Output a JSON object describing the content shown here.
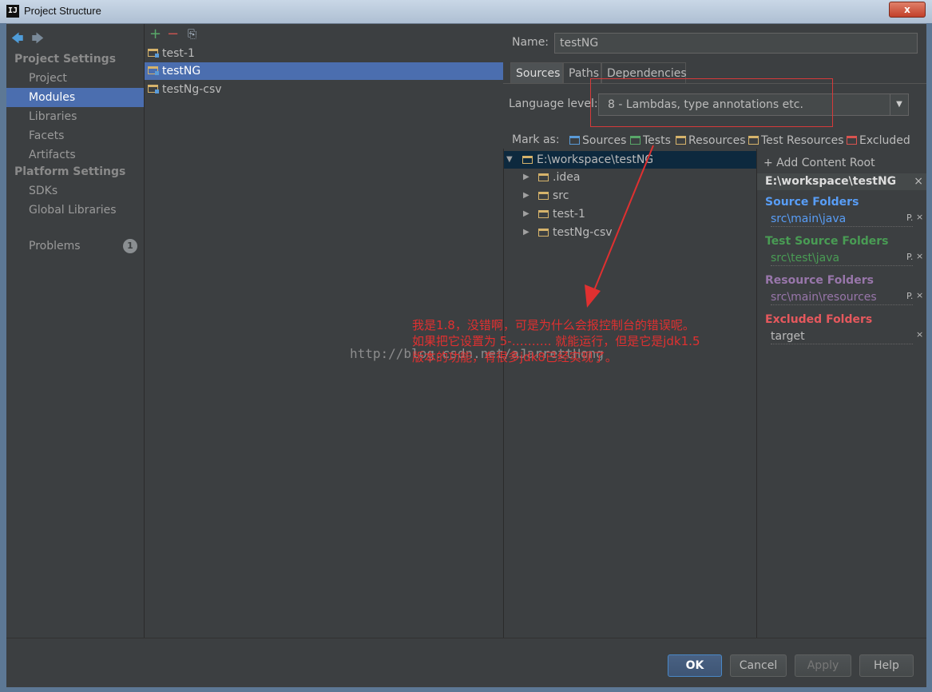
{
  "window": {
    "title": "Project Structure",
    "app_icon": "IJ",
    "close_label": "x"
  },
  "nav": {
    "back_icon": "🡄",
    "forward_icon": "🡆"
  },
  "sidebar": {
    "project_settings_header": "Project Settings",
    "project_items": [
      "Project",
      "Modules",
      "Libraries",
      "Facets",
      "Artifacts"
    ],
    "platform_settings_header": "Platform Settings",
    "platform_items": [
      "SDKs",
      "Global Libraries"
    ],
    "problems_label": "Problems",
    "problems_count": "1",
    "selected": "Modules"
  },
  "modules": {
    "toolbar": {
      "add": "+",
      "remove": "−",
      "copy": "⎘"
    },
    "items": [
      "test-1",
      "testNG",
      "testNg-csv"
    ],
    "selected": "testNG"
  },
  "detail": {
    "name_label": "Name:",
    "name_value": "testNG",
    "tabs": [
      "Sources",
      "Paths",
      "Dependencies"
    ],
    "active_tab": "Sources",
    "language_level_label": "Language level:",
    "language_level_value": "8 - Lambdas, type annotations etc.",
    "mark_as_label": "Mark as:",
    "mark_types": [
      {
        "label": "Sources",
        "color": "#5a9bd8"
      },
      {
        "label": "Tests",
        "color": "#59a869"
      },
      {
        "label": "Resources",
        "color": "#d6b36b"
      },
      {
        "label": "Test Resources",
        "color": "#d6b36b"
      },
      {
        "label": "Excluded",
        "color": "#d9534f"
      }
    ]
  },
  "tree": {
    "root": "E:\\workspace\\testNG",
    "children": [
      ".idea",
      "src",
      "test-1",
      "testNg-csv"
    ]
  },
  "content_root": {
    "add_label": "+ Add Content Root",
    "path": "E:\\workspace\\testNG",
    "close": "×",
    "categories": [
      {
        "title": "Source Folders",
        "path": "src\\main\\java",
        "color": "#589df6"
      },
      {
        "title": "Test Source Folders",
        "path": "src\\test\\java",
        "color": "#499c54"
      },
      {
        "title": "Resource Folders",
        "path": "src\\main\\resources",
        "color": "#9876aa"
      },
      {
        "title": "Excluded Folders",
        "path": "target",
        "color": "#e5585d"
      }
    ],
    "path_action": "P."
  },
  "annotation": {
    "line1": "我是1.8，没错啊，可是为什么会报控制台的错误呢。",
    "line2": "如果把它设置为 5-………. 就能运行，但是它是jdk1.5",
    "line3": "版本的功能，有很多jdk8已经实现了。",
    "watermark": "http://blog.csdn.net/aJarrettHong"
  },
  "footer": {
    "ok": "OK",
    "cancel": "Cancel",
    "apply": "Apply",
    "help": "Help"
  }
}
